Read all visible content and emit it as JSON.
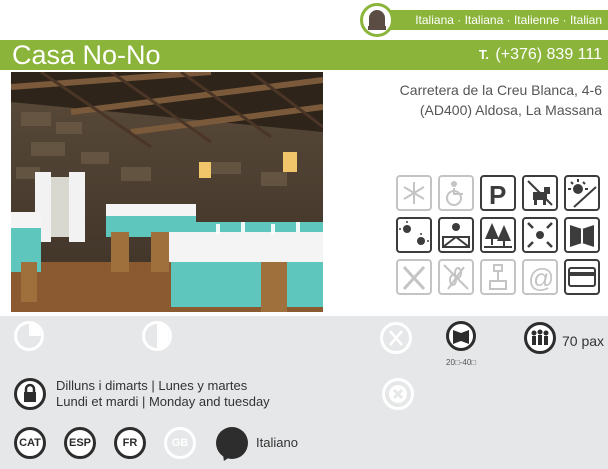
{
  "header": {
    "cuisine": "Italiana · Italiana · Italienne · Italian",
    "title": "Casa No-No",
    "phone_prefix": "T.",
    "phone": "(+376) 839 111"
  },
  "address": {
    "line1": "Carretera de la Creu Blanca, 4-6",
    "line2": "(AD400) Aldosa, La Massana"
  },
  "services": [
    {
      "name": "air-conditioning-icon",
      "active": false
    },
    {
      "name": "wheelchair-icon",
      "active": false
    },
    {
      "name": "parking-icon",
      "active": true
    },
    {
      "name": "pets-allowed-icon",
      "active": true
    },
    {
      "name": "terrace-icon",
      "active": true
    },
    {
      "name": "sun-icon",
      "active": true
    },
    {
      "name": "mountain-view-icon",
      "active": true
    },
    {
      "name": "trees-icon",
      "active": true
    },
    {
      "name": "play-area-icon",
      "active": true
    },
    {
      "name": "menu-icon",
      "active": true
    },
    {
      "name": "cutlery-icon",
      "active": false
    },
    {
      "name": "gluten-free-icon",
      "active": false
    },
    {
      "name": "baby-chair-icon",
      "active": false
    },
    {
      "name": "email-icon",
      "active": false
    },
    {
      "name": "credit-card-icon",
      "active": true
    }
  ],
  "info": {
    "capacity": "70 pax",
    "menu_price": "20□-40□",
    "closed_days_1": "Dilluns i dimarts | Lunes y martes",
    "closed_days_2": "Lundi et mardi | Monday and tuesday"
  },
  "languages": {
    "cat": "CAT",
    "esp": "ESP",
    "fr": "FR",
    "gb": "GB",
    "other": "Italiano"
  },
  "colors": {
    "accent": "#8bb43a",
    "panel": "#e6e7e8",
    "icon_active": "#3c3c3c",
    "icon_inactive": "#c4c4c4"
  }
}
